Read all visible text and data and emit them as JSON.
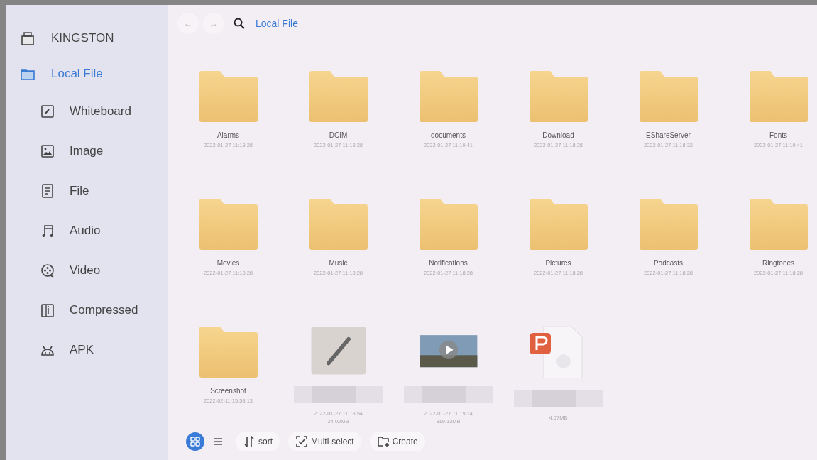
{
  "nav": {
    "back": "←",
    "forward": "→",
    "path": "Local File"
  },
  "sidebar": {
    "items": [
      {
        "label": "KINGSTON",
        "kind": "drive",
        "selected": false
      },
      {
        "label": "Local File",
        "kind": "folder",
        "selected": true,
        "children": [
          {
            "label": "Whiteboard",
            "kind": "whiteboard",
            "selected": false
          },
          {
            "label": "Image",
            "kind": "image",
            "selected": false
          },
          {
            "label": "File",
            "kind": "file",
            "selected": false
          },
          {
            "label": "Audio",
            "kind": "audio",
            "selected": false
          },
          {
            "label": "Video",
            "kind": "video",
            "selected": false
          },
          {
            "label": "Compressed",
            "kind": "compressed",
            "selected": false
          },
          {
            "label": "APK",
            "kind": "apk",
            "selected": false
          }
        ]
      }
    ]
  },
  "items": [
    {
      "kind": "folder",
      "name": "Alarms",
      "date": "2022-01-27 11:18:28"
    },
    {
      "kind": "folder",
      "name": "DCIM",
      "date": "2022-01-27 11:18:28"
    },
    {
      "kind": "folder",
      "name": "documents",
      "date": "2022-01-27 11:19:41"
    },
    {
      "kind": "folder",
      "name": "Download",
      "date": "2022-01-27 11:18:28"
    },
    {
      "kind": "folder",
      "name": "EShareServer",
      "date": "2022-01-27 11:18:32"
    },
    {
      "kind": "folder",
      "name": "Fonts",
      "date": "2022-01-27 11:19:41"
    },
    {
      "kind": "folder",
      "name": "Movies",
      "date": "2022-01-27 11:18:28"
    },
    {
      "kind": "folder",
      "name": "Music",
      "date": "2022-01-27 11:18:28"
    },
    {
      "kind": "folder",
      "name": "Notifications",
      "date": "2022-01-27 11:18:28"
    },
    {
      "kind": "folder",
      "name": "Pictures",
      "date": "2022-01-27 11:18:28"
    },
    {
      "kind": "folder",
      "name": "Podcasts",
      "date": "2022-01-27 11:18:28"
    },
    {
      "kind": "folder",
      "name": "Ringtones",
      "date": "2022-01-27 11:18:28"
    },
    {
      "kind": "folder",
      "name": "Screenshot",
      "date": "2022-02-11 15:58:13"
    },
    {
      "kind": "whiteboard",
      "date": "2022-01-27 11:18:54",
      "size": "24.02MB"
    },
    {
      "kind": "video",
      "date": "2022-01-27 11:19:14",
      "size": "319.13MB"
    },
    {
      "kind": "presentation",
      "size": "4.57MB"
    }
  ],
  "toolbar": {
    "views": [
      {
        "kind": "grid",
        "selected": true
      },
      {
        "kind": "list",
        "selected": false
      }
    ],
    "buttons": [
      {
        "kind": "sort",
        "label": "sort"
      },
      {
        "kind": "multiselect",
        "label": "Multi-select"
      },
      {
        "kind": "create",
        "label": "Create"
      }
    ]
  }
}
